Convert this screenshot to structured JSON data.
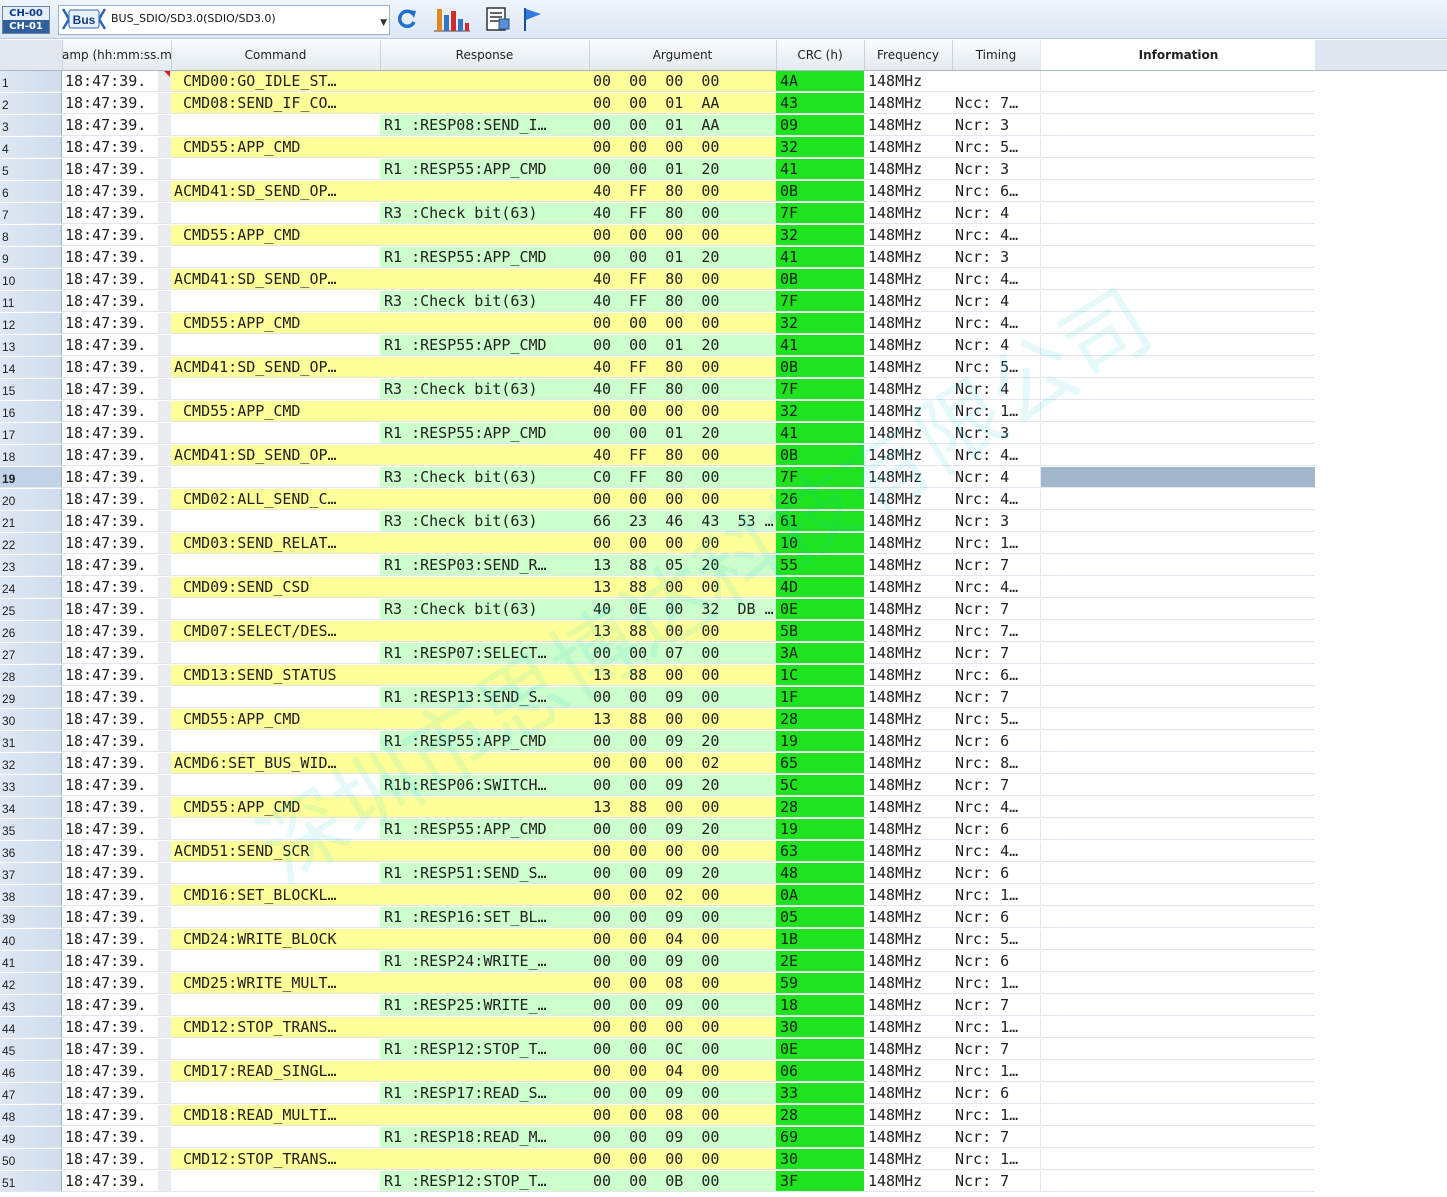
{
  "toolbar": {
    "channels": [
      "CH-00",
      "CH-01"
    ],
    "bus_icon_label": "Bus",
    "bus_select_value": "BUS_SDIO/SD3.0(SDIO/SD3.0)",
    "icons": [
      "refresh-icon",
      "bar-chart-icon",
      "report-icon",
      "flag-icon"
    ]
  },
  "watermark": "深圳市思博达科技有限公司",
  "columns": {
    "timestamp": "amp (hh:mm:ss.ms",
    "command": "Command",
    "response": "Response",
    "argument": "Argument",
    "crc": "CRC (h)",
    "frequency": "Frequency",
    "timing": "Timing",
    "information": "Information"
  },
  "colors": {
    "command_row": "#ffff99",
    "response_row": "#ccffcc",
    "crc_cell": "#1fe31f",
    "selected": "#a2b7cc"
  },
  "selected_row": 19,
  "rows": [
    {
      "n": "1",
      "ts": "18:47:39.",
      "cmd": " CMD00:GO_IDLE_ST…",
      "resp": "",
      "arg": "00  00  00  00",
      "crc": "4A",
      "freq": "148MHz",
      "tim": ""
    },
    {
      "n": "2",
      "ts": "18:47:39.",
      "cmd": " CMD08:SEND_IF_CO…",
      "resp": "",
      "arg": "00  00  01  AA",
      "crc": "43",
      "freq": "148MHz",
      "tim": "Ncc: 7…"
    },
    {
      "n": "3",
      "ts": "18:47:39.",
      "cmd": "",
      "resp": "R1 :RESP08:SEND_I…",
      "arg": "00  00  01  AA",
      "crc": "09",
      "freq": "148MHz",
      "tim": "Ncr: 3"
    },
    {
      "n": "4",
      "ts": "18:47:39.",
      "cmd": " CMD55:APP_CMD",
      "resp": "",
      "arg": "00  00  00  00",
      "crc": "32",
      "freq": "148MHz",
      "tim": "Nrc: 5…"
    },
    {
      "n": "5",
      "ts": "18:47:39.",
      "cmd": "",
      "resp": "R1 :RESP55:APP_CMD",
      "arg": "00  00  01  20",
      "crc": "41",
      "freq": "148MHz",
      "tim": "Ncr: 3"
    },
    {
      "n": "6",
      "ts": "18:47:39.",
      "cmd": "ACMD41:SD_SEND_OP…",
      "resp": "",
      "arg": "40  FF  80  00",
      "crc": "0B",
      "freq": "148MHz",
      "tim": "Nrc: 6…"
    },
    {
      "n": "7",
      "ts": "18:47:39.",
      "cmd": "",
      "resp": "R3 :Check bit(63)",
      "arg": "40  FF  80  00",
      "crc": "7F",
      "freq": "148MHz",
      "tim": "Ncr: 4"
    },
    {
      "n": "8",
      "ts": "18:47:39.",
      "cmd": " CMD55:APP_CMD",
      "resp": "",
      "arg": "00  00  00  00",
      "crc": "32",
      "freq": "148MHz",
      "tim": "Nrc: 4…"
    },
    {
      "n": "9",
      "ts": "18:47:39.",
      "cmd": "",
      "resp": "R1 :RESP55:APP_CMD",
      "arg": "00  00  01  20",
      "crc": "41",
      "freq": "148MHz",
      "tim": "Ncr: 3"
    },
    {
      "n": "10",
      "ts": "18:47:39.",
      "cmd": "ACMD41:SD_SEND_OP…",
      "resp": "",
      "arg": "40  FF  80  00",
      "crc": "0B",
      "freq": "148MHz",
      "tim": "Nrc: 4…"
    },
    {
      "n": "11",
      "ts": "18:47:39.",
      "cmd": "",
      "resp": "R3 :Check bit(63)",
      "arg": "40  FF  80  00",
      "crc": "7F",
      "freq": "148MHz",
      "tim": "Ncr: 4"
    },
    {
      "n": "12",
      "ts": "18:47:39.",
      "cmd": " CMD55:APP_CMD",
      "resp": "",
      "arg": "00  00  00  00",
      "crc": "32",
      "freq": "148MHz",
      "tim": "Nrc: 4…"
    },
    {
      "n": "13",
      "ts": "18:47:39.",
      "cmd": "",
      "resp": "R1 :RESP55:APP_CMD",
      "arg": "00  00  01  20",
      "crc": "41",
      "freq": "148MHz",
      "tim": "Ncr: 4"
    },
    {
      "n": "14",
      "ts": "18:47:39.",
      "cmd": "ACMD41:SD_SEND_OP…",
      "resp": "",
      "arg": "40  FF  80  00",
      "crc": "0B",
      "freq": "148MHz",
      "tim": "Nrc: 5…"
    },
    {
      "n": "15",
      "ts": "18:47:39.",
      "cmd": "",
      "resp": "R3 :Check bit(63)",
      "arg": "40  FF  80  00",
      "crc": "7F",
      "freq": "148MHz",
      "tim": "Ncr: 4"
    },
    {
      "n": "16",
      "ts": "18:47:39.",
      "cmd": " CMD55:APP_CMD",
      "resp": "",
      "arg": "00  00  00  00",
      "crc": "32",
      "freq": "148MHz",
      "tim": "Nrc: 1…"
    },
    {
      "n": "17",
      "ts": "18:47:39.",
      "cmd": "",
      "resp": "R1 :RESP55:APP_CMD",
      "arg": "00  00  01  20",
      "crc": "41",
      "freq": "148MHz",
      "tim": "Ncr: 3"
    },
    {
      "n": "18",
      "ts": "18:47:39.",
      "cmd": "ACMD41:SD_SEND_OP…",
      "resp": "",
      "arg": "40  FF  80  00",
      "crc": "0B",
      "freq": "148MHz",
      "tim": "Nrc: 4…"
    },
    {
      "n": "19",
      "ts": "18:47:39.",
      "cmd": "",
      "resp": "R3 :Check bit(63)",
      "arg": "C0  FF  80  00",
      "crc": "7F",
      "freq": "148MHz",
      "tim": "Ncr: 4"
    },
    {
      "n": "20",
      "ts": "18:47:39.",
      "cmd": " CMD02:ALL_SEND_C…",
      "resp": "",
      "arg": "00  00  00  00",
      "crc": "26",
      "freq": "148MHz",
      "tim": "Nrc: 4…"
    },
    {
      "n": "21",
      "ts": "18:47:39.",
      "cmd": "",
      "resp": "R3 :Check bit(63)",
      "arg": "66  23  46  43  53 …",
      "crc": "61",
      "freq": "148MHz",
      "tim": "Ncr: 3"
    },
    {
      "n": "22",
      "ts": "18:47:39.",
      "cmd": " CMD03:SEND_RELAT…",
      "resp": "",
      "arg": "00  00  00  00",
      "crc": "10",
      "freq": "148MHz",
      "tim": "Nrc: 1…"
    },
    {
      "n": "23",
      "ts": "18:47:39.",
      "cmd": "",
      "resp": "R1 :RESP03:SEND_R…",
      "arg": "13  88  05  20",
      "crc": "55",
      "freq": "148MHz",
      "tim": "Ncr: 7"
    },
    {
      "n": "24",
      "ts": "18:47:39.",
      "cmd": " CMD09:SEND_CSD",
      "resp": "",
      "arg": "13  88  00  00",
      "crc": "4D",
      "freq": "148MHz",
      "tim": "Nrc: 4…"
    },
    {
      "n": "25",
      "ts": "18:47:39.",
      "cmd": "",
      "resp": "R3 :Check bit(63)",
      "arg": "40  0E  00  32  DB …",
      "crc": "0E",
      "freq": "148MHz",
      "tim": "Ncr: 7"
    },
    {
      "n": "26",
      "ts": "18:47:39.",
      "cmd": " CMD07:SELECT/DES…",
      "resp": "",
      "arg": "13  88  00  00",
      "crc": "5B",
      "freq": "148MHz",
      "tim": "Nrc: 7…"
    },
    {
      "n": "27",
      "ts": "18:47:39.",
      "cmd": "",
      "resp": "R1 :RESP07:SELECT…",
      "arg": "00  00  07  00",
      "crc": "3A",
      "freq": "148MHz",
      "tim": "Ncr: 7"
    },
    {
      "n": "28",
      "ts": "18:47:39.",
      "cmd": " CMD13:SEND_STATUS",
      "resp": "",
      "arg": "13  88  00  00",
      "crc": "1C",
      "freq": "148MHz",
      "tim": "Nrc: 6…"
    },
    {
      "n": "29",
      "ts": "18:47:39.",
      "cmd": "",
      "resp": "R1 :RESP13:SEND_S…",
      "arg": "00  00  09  00",
      "crc": "1F",
      "freq": "148MHz",
      "tim": "Ncr: 7"
    },
    {
      "n": "30",
      "ts": "18:47:39.",
      "cmd": " CMD55:APP_CMD",
      "resp": "",
      "arg": "13  88  00  00",
      "crc": "28",
      "freq": "148MHz",
      "tim": "Nrc: 5…"
    },
    {
      "n": "31",
      "ts": "18:47:39.",
      "cmd": "",
      "resp": "R1 :RESP55:APP_CMD",
      "arg": "00  00  09  20",
      "crc": "19",
      "freq": "148MHz",
      "tim": "Ncr: 6"
    },
    {
      "n": "32",
      "ts": "18:47:39.",
      "cmd": "ACMD6:SET_BUS_WID…",
      "resp": "",
      "arg": "00  00  00  02",
      "crc": "65",
      "freq": "148MHz",
      "tim": "Nrc: 8…"
    },
    {
      "n": "33",
      "ts": "18:47:39.",
      "cmd": "",
      "resp": "R1b:RESP06:SWITCH…",
      "arg": "00  00  09  20",
      "crc": "5C",
      "freq": "148MHz",
      "tim": "Ncr: 7"
    },
    {
      "n": "34",
      "ts": "18:47:39.",
      "cmd": " CMD55:APP_CMD",
      "resp": "",
      "arg": "13  88  00  00",
      "crc": "28",
      "freq": "148MHz",
      "tim": "Nrc: 4…"
    },
    {
      "n": "35",
      "ts": "18:47:39.",
      "cmd": "",
      "resp": "R1 :RESP55:APP_CMD",
      "arg": "00  00  09  20",
      "crc": "19",
      "freq": "148MHz",
      "tim": "Ncr: 6"
    },
    {
      "n": "36",
      "ts": "18:47:39.",
      "cmd": "ACMD51:SEND_SCR",
      "resp": "",
      "arg": "00  00  00  00",
      "crc": "63",
      "freq": "148MHz",
      "tim": "Nrc: 4…"
    },
    {
      "n": "37",
      "ts": "18:47:39.",
      "cmd": "",
      "resp": "R1 :RESP51:SEND_S…",
      "arg": "00  00  09  20",
      "crc": "48",
      "freq": "148MHz",
      "tim": "Ncr: 6"
    },
    {
      "n": "38",
      "ts": "18:47:39.",
      "cmd": " CMD16:SET_BLOCKL…",
      "resp": "",
      "arg": "00  00  02  00",
      "crc": "0A",
      "freq": "148MHz",
      "tim": "Nrc: 1…"
    },
    {
      "n": "39",
      "ts": "18:47:39.",
      "cmd": "",
      "resp": "R1 :RESP16:SET_BL…",
      "arg": "00  00  09  00",
      "crc": "05",
      "freq": "148MHz",
      "tim": "Ncr: 6"
    },
    {
      "n": "40",
      "ts": "18:47:39.",
      "cmd": " CMD24:WRITE_BLOCK",
      "resp": "",
      "arg": "00  00  04  00",
      "crc": "1B",
      "freq": "148MHz",
      "tim": "Nrc: 5…"
    },
    {
      "n": "41",
      "ts": "18:47:39.",
      "cmd": "",
      "resp": "R1 :RESP24:WRITE_…",
      "arg": "00  00  09  00",
      "crc": "2E",
      "freq": "148MHz",
      "tim": "Ncr: 6"
    },
    {
      "n": "42",
      "ts": "18:47:39.",
      "cmd": " CMD25:WRITE_MULT…",
      "resp": "",
      "arg": "00  00  08  00",
      "crc": "59",
      "freq": "148MHz",
      "tim": "Nrc: 1…"
    },
    {
      "n": "43",
      "ts": "18:47:39.",
      "cmd": "",
      "resp": "R1 :RESP25:WRITE_…",
      "arg": "00  00  09  00",
      "crc": "18",
      "freq": "148MHz",
      "tim": "Ncr: 7"
    },
    {
      "n": "44",
      "ts": "18:47:39.",
      "cmd": " CMD12:STOP_TRANS…",
      "resp": "",
      "arg": "00  00  00  00",
      "crc": "30",
      "freq": "148MHz",
      "tim": "Nrc: 1…"
    },
    {
      "n": "45",
      "ts": "18:47:39.",
      "cmd": "",
      "resp": "R1 :RESP12:STOP_T…",
      "arg": "00  00  0C  00",
      "crc": "0E",
      "freq": "148MHz",
      "tim": "Ncr: 7"
    },
    {
      "n": "46",
      "ts": "18:47:39.",
      "cmd": " CMD17:READ_SINGL…",
      "resp": "",
      "arg": "00  00  04  00",
      "crc": "06",
      "freq": "148MHz",
      "tim": "Nrc: 1…"
    },
    {
      "n": "47",
      "ts": "18:47:39.",
      "cmd": "",
      "resp": "R1 :RESP17:READ_S…",
      "arg": "00  00  09  00",
      "crc": "33",
      "freq": "148MHz",
      "tim": "Ncr: 6"
    },
    {
      "n": "48",
      "ts": "18:47:39.",
      "cmd": " CMD18:READ_MULTI…",
      "resp": "",
      "arg": "00  00  08  00",
      "crc": "28",
      "freq": "148MHz",
      "tim": "Nrc: 1…"
    },
    {
      "n": "49",
      "ts": "18:47:39.",
      "cmd": "",
      "resp": "R1 :RESP18:READ_M…",
      "arg": "00  00  09  00",
      "crc": "69",
      "freq": "148MHz",
      "tim": "Ncr: 7"
    },
    {
      "n": "50",
      "ts": "18:47:39.",
      "cmd": " CMD12:STOP_TRANS…",
      "resp": "",
      "arg": "00  00  00  00",
      "crc": "30",
      "freq": "148MHz",
      "tim": "Nrc: 1…"
    },
    {
      "n": "51",
      "ts": "18:47:39.",
      "cmd": "",
      "resp": "R1 :RESP12:STOP_T…",
      "arg": "00  00  0B  00",
      "crc": "3F",
      "freq": "148MHz",
      "tim": "Ncr: 7"
    }
  ]
}
